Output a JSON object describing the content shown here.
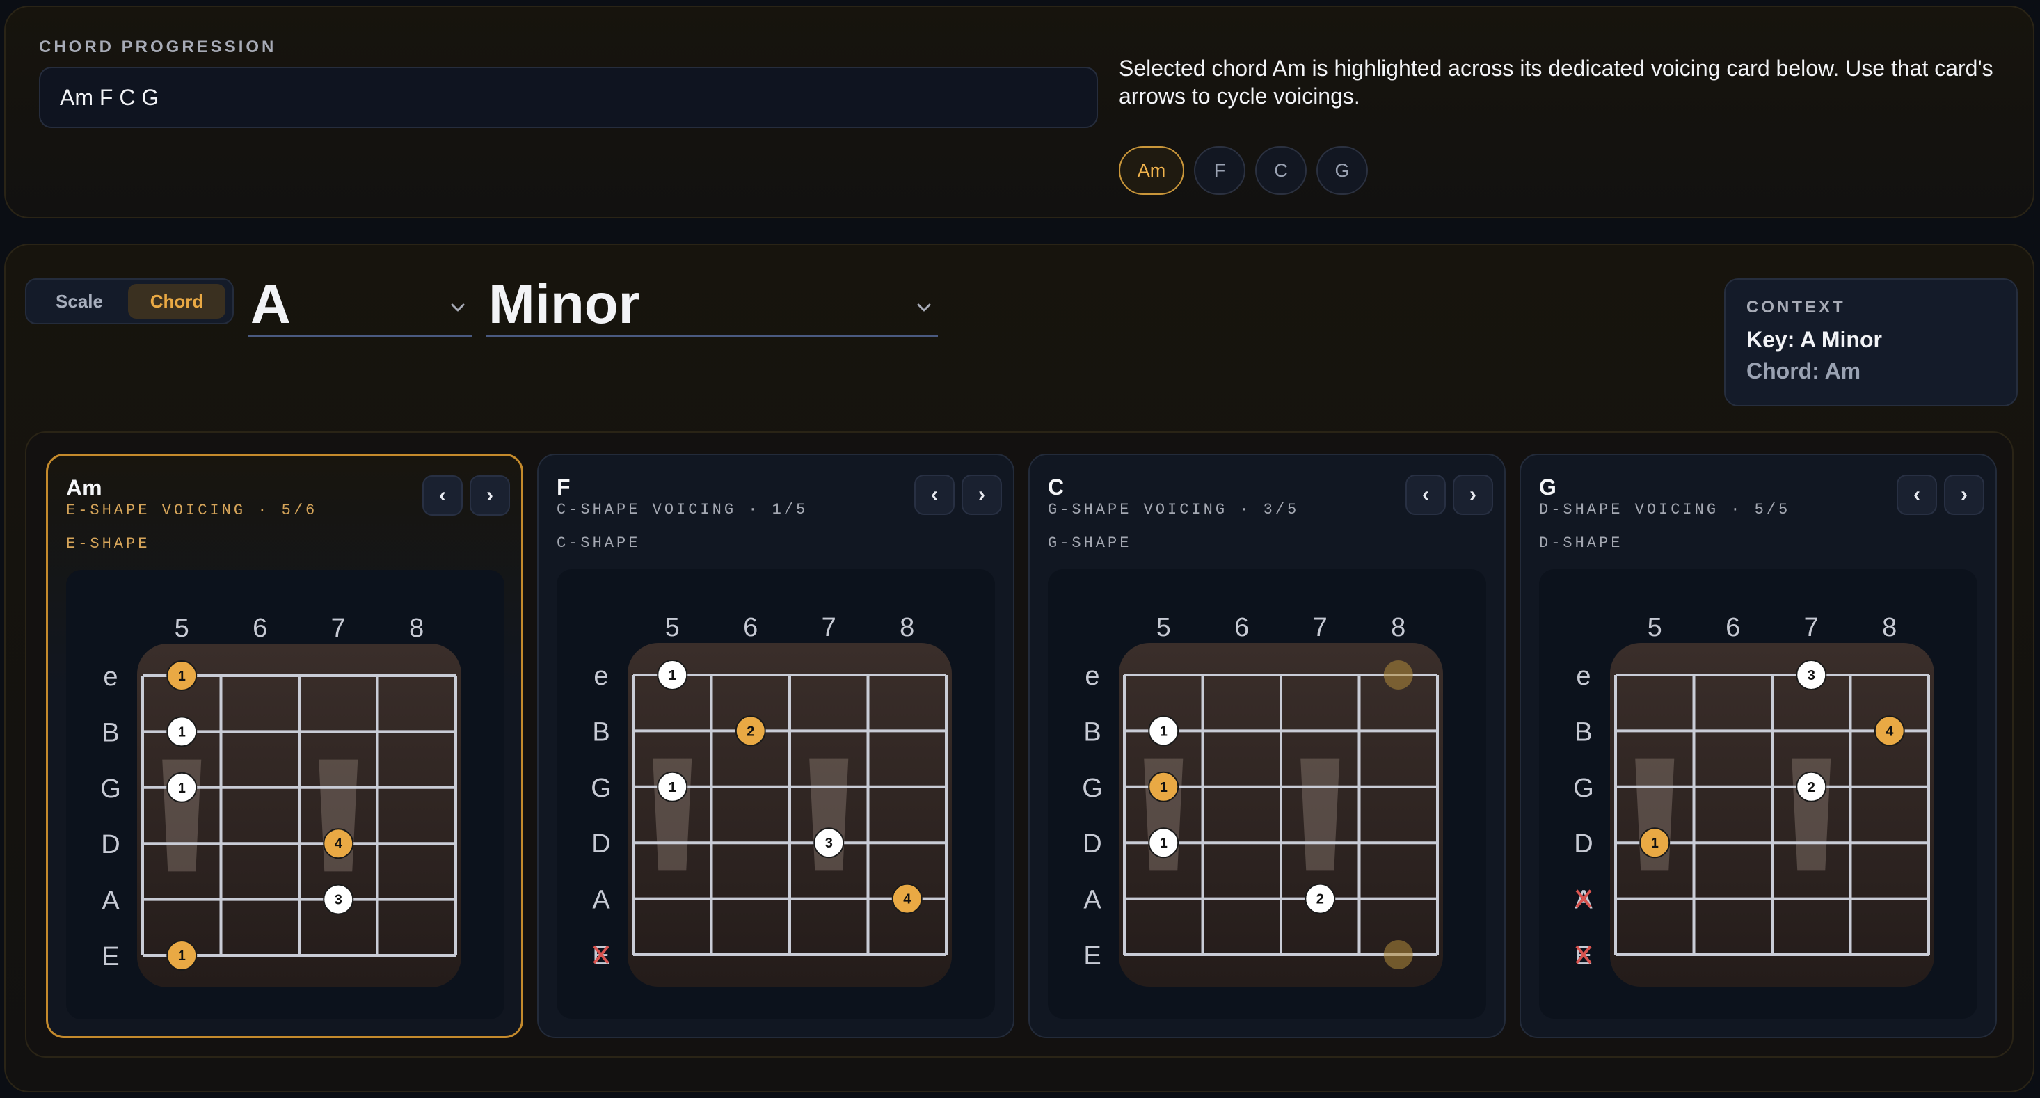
{
  "progression": {
    "label": "CHORD PROGRESSION",
    "value": "Am F C G",
    "info": "Selected chord Am is highlighted across its dedicated voicing card below. Use that card's arrows to cycle voicings.",
    "chips": [
      {
        "label": "Am",
        "active": true
      },
      {
        "label": "F",
        "active": false
      },
      {
        "label": "C",
        "active": false
      },
      {
        "label": "G",
        "active": false
      }
    ]
  },
  "mode": {
    "scale_label": "Scale",
    "chord_label": "Chord",
    "selected": "Chord"
  },
  "root": {
    "value": "A"
  },
  "quality": {
    "value": "Minor"
  },
  "context": {
    "title": "CONTEXT",
    "key": "Key: A Minor",
    "chord": "Chord: Am"
  },
  "colors": {
    "accent": "#e9a944",
    "muted_x": "#d9534f"
  },
  "cards": [
    {
      "name": "Am",
      "voicing": "E-SHAPE VOICING · 5/6",
      "shape": "E-SHAPE",
      "selected": true,
      "frets": [
        "5",
        "6",
        "7",
        "8"
      ],
      "strings": [
        "e",
        "B",
        "G",
        "D",
        "A",
        "E"
      ],
      "muted": [],
      "notes": [
        {
          "string": 0,
          "fret": 0,
          "finger": "1",
          "root": true
        },
        {
          "string": 1,
          "fret": 0,
          "finger": "1",
          "root": false
        },
        {
          "string": 2,
          "fret": 0,
          "finger": "1",
          "root": false
        },
        {
          "string": 3,
          "fret": 2,
          "finger": "4",
          "root": true
        },
        {
          "string": 4,
          "fret": 2,
          "finger": "3",
          "root": false
        },
        {
          "string": 5,
          "fret": 0,
          "finger": "1",
          "root": true
        }
      ],
      "ghosts": []
    },
    {
      "name": "F",
      "voicing": "C-SHAPE VOICING · 1/5",
      "shape": "C-SHAPE",
      "selected": false,
      "frets": [
        "5",
        "6",
        "7",
        "8"
      ],
      "strings": [
        "e",
        "B",
        "G",
        "D",
        "A",
        "E"
      ],
      "muted": [
        5
      ],
      "notes": [
        {
          "string": 0,
          "fret": 0,
          "finger": "1",
          "root": false
        },
        {
          "string": 1,
          "fret": 1,
          "finger": "2",
          "root": true
        },
        {
          "string": 2,
          "fret": 0,
          "finger": "1",
          "root": false
        },
        {
          "string": 3,
          "fret": 2,
          "finger": "3",
          "root": false
        },
        {
          "string": 4,
          "fret": 3,
          "finger": "4",
          "root": true
        }
      ],
      "ghosts": []
    },
    {
      "name": "C",
      "voicing": "G-SHAPE VOICING · 3/5",
      "shape": "G-SHAPE",
      "selected": false,
      "frets": [
        "5",
        "6",
        "7",
        "8"
      ],
      "strings": [
        "e",
        "B",
        "G",
        "D",
        "A",
        "E"
      ],
      "muted": [],
      "notes": [
        {
          "string": 1,
          "fret": 0,
          "finger": "1",
          "root": false
        },
        {
          "string": 2,
          "fret": 0,
          "finger": "1",
          "root": true
        },
        {
          "string": 3,
          "fret": 0,
          "finger": "1",
          "root": false
        },
        {
          "string": 4,
          "fret": 2,
          "finger": "2",
          "root": false
        }
      ],
      "ghosts": [
        {
          "string": 0,
          "fret": 3
        },
        {
          "string": 5,
          "fret": 3
        }
      ]
    },
    {
      "name": "G",
      "voicing": "D-SHAPE VOICING · 5/5",
      "shape": "D-SHAPE",
      "selected": false,
      "frets": [
        "5",
        "6",
        "7",
        "8"
      ],
      "strings": [
        "e",
        "B",
        "G",
        "D",
        "A",
        "E"
      ],
      "muted": [
        4,
        5
      ],
      "notes": [
        {
          "string": 0,
          "fret": 2,
          "finger": "3",
          "root": false
        },
        {
          "string": 1,
          "fret": 3,
          "finger": "4",
          "root": true
        },
        {
          "string": 2,
          "fret": 2,
          "finger": "2",
          "root": false
        },
        {
          "string": 3,
          "fret": 0,
          "finger": "1",
          "root": true
        }
      ],
      "ghosts": []
    }
  ]
}
